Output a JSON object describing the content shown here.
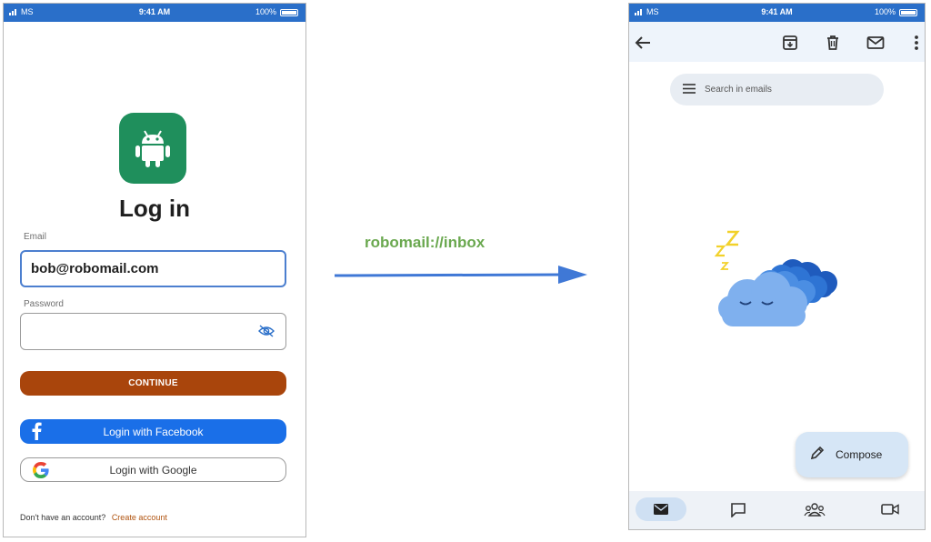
{
  "login_screen": {
    "status_bar": {
      "carrier": "MS",
      "time": "9:41 AM",
      "battery": "100%"
    },
    "title": "Log in",
    "email": {
      "label": "Email",
      "value": "bob@robomail.com"
    },
    "password": {
      "label": "Password",
      "value": ""
    },
    "continue_label": "CONTINUE",
    "facebook_label": "Login with Facebook",
    "google_label": "Login with Google",
    "signup_prompt": "Don't have an account?",
    "signup_link": "Create account"
  },
  "deep_link": {
    "label": "robomail://inbox"
  },
  "inbox_screen": {
    "status_bar": {
      "carrier": "MS",
      "time": "9:41 AM",
      "battery": "100%"
    },
    "toolbar_icons": [
      "back-arrow-icon",
      "archive-icon",
      "trash-icon",
      "mail-icon",
      "more-vert-icon"
    ],
    "search_placeholder": "Search in emails",
    "compose_label": "Compose",
    "bottom_nav_icons": [
      "mail-icon",
      "chat-icon",
      "meet-group-icon",
      "video-icon"
    ]
  },
  "colors": {
    "status_bar": "#2a6fc9",
    "app_logo": "#1f8f5c",
    "continue_button": "#a9450c",
    "facebook_button": "#1a6fe8",
    "deep_link_text": "#6aa84f",
    "arrow": "#3f78d6"
  }
}
